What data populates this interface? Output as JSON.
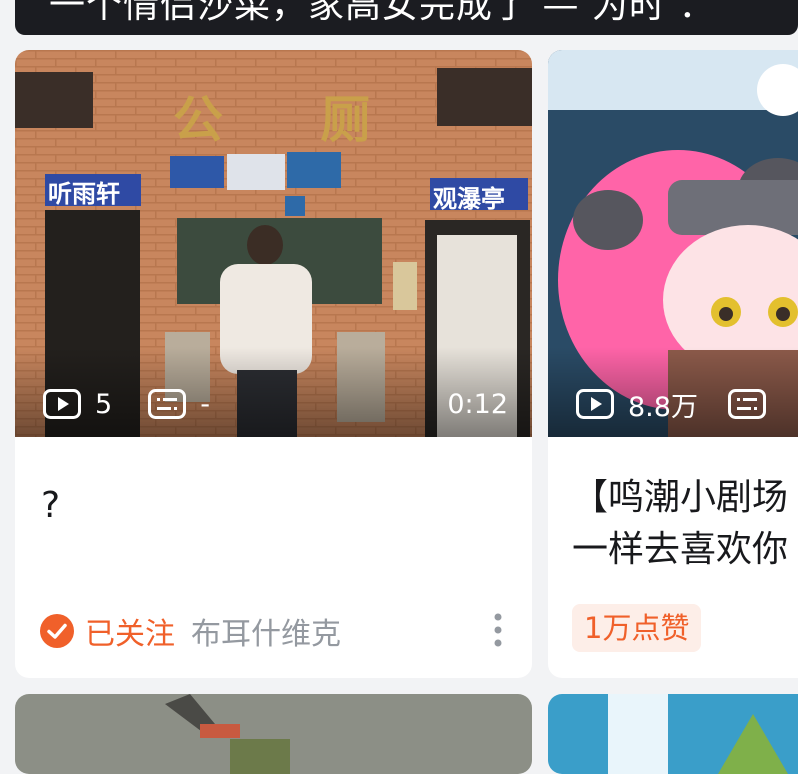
{
  "top_strip": {
    "text": "一个情侣沙菜，家高女完成了 — 为时 ："
  },
  "cards": [
    {
      "play_count": "5",
      "danmaku_count": "-",
      "duration": "0:12",
      "title": "?",
      "follow_label": "已关注",
      "uploader": "布耳什维克",
      "thumb_signs": {
        "top": "公 厕",
        "left": "听雨轩",
        "right": "观瀑亭"
      }
    },
    {
      "play_count": "8.8万",
      "title_line1": "【鸣潮小剧场",
      "title_line2": "一样去喜欢你",
      "like_badge": "1万点赞"
    }
  ],
  "colors": {
    "accent": "#f0602a",
    "accent_bg": "#fdeee8",
    "secondary_text": "#9499a0",
    "page_bg": "#f2f3f5"
  }
}
